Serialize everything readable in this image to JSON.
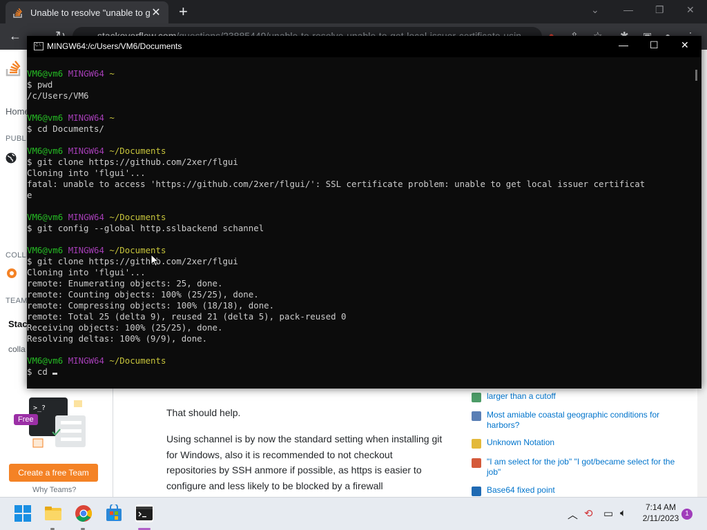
{
  "browser": {
    "tab_title": "Unable to resolve \"unable to get",
    "close_tab": "✕",
    "new_tab": "+",
    "address_host": "stackoverflow.com",
    "address_path": "/questions/23885449/unable-to-resolve-unable-to-get-local-issuer-certificate-usin"
  },
  "page": {
    "left_nav": {
      "home": "Home",
      "public": "PUBLIC",
      "collectives": "COLLE",
      "teams": "TEAMS",
      "stack_teams_title": "Stac Team",
      "teams_desc": "colla shar know",
      "free_badge": "Free",
      "create_team": "Create a free Team",
      "why_teams": "Why Teams?"
    },
    "answer": {
      "p1": "That should help.",
      "p2": "Using schannel is by now the standard setting when installing git for Windows, also it is recommended to not checkout repositories by SSH anmore if possible, as https is easier to configure and less likely to be blocked by a firewall"
    },
    "hot_questions": [
      {
        "text": "larger than a cutoff",
        "icon_color": "#4d9c68"
      },
      {
        "text": "Most amiable coastal geographic conditions for harbors?",
        "icon_color": "#5a7fb5"
      },
      {
        "text": "Unknown Notation",
        "icon_color": "#e3b93b"
      },
      {
        "text": "\"I am select for the job\" \"I got/became select for the job\"",
        "icon_color": "#d45a3a"
      },
      {
        "text": "Base64 fixed point",
        "icon_color": "#1f6ab3"
      }
    ]
  },
  "terminal": {
    "title": "MINGW64:/c/Users/VM6/Documents",
    "lines": [
      {
        "type": "prompt",
        "user": "VM6@vm6",
        "host": "MINGW64",
        "dir": "~"
      },
      {
        "type": "cmd",
        "text": "$ pwd"
      },
      {
        "type": "out",
        "text": "/c/Users/VM6"
      },
      {
        "type": "blank",
        "text": ""
      },
      {
        "type": "prompt",
        "user": "VM6@vm6",
        "host": "MINGW64",
        "dir": "~"
      },
      {
        "type": "cmd",
        "text": "$ cd Documents/"
      },
      {
        "type": "blank",
        "text": ""
      },
      {
        "type": "prompt",
        "user": "VM6@vm6",
        "host": "MINGW64",
        "dir": "~/Documents"
      },
      {
        "type": "cmd",
        "text": "$ git clone https://github.com/2xer/flgui"
      },
      {
        "type": "out",
        "text": "Cloning into 'flgui'..."
      },
      {
        "type": "out",
        "text": "fatal: unable to access 'https://github.com/2xer/flgui/': SSL certificate problem: unable to get local issuer certificat"
      },
      {
        "type": "out",
        "text": "e"
      },
      {
        "type": "blank",
        "text": ""
      },
      {
        "type": "prompt",
        "user": "VM6@vm6",
        "host": "MINGW64",
        "dir": "~/Documents"
      },
      {
        "type": "cmd",
        "text": "$ git config --global http.sslbackend schannel"
      },
      {
        "type": "blank",
        "text": ""
      },
      {
        "type": "prompt",
        "user": "VM6@vm6",
        "host": "MINGW64",
        "dir": "~/Documents"
      },
      {
        "type": "cmd",
        "text": "$ git clone https://github.com/2xer/flgui"
      },
      {
        "type": "out",
        "text": "Cloning into 'flgui'..."
      },
      {
        "type": "out",
        "text": "remote: Enumerating objects: 25, done."
      },
      {
        "type": "out",
        "text": "remote: Counting objects: 100% (25/25), done."
      },
      {
        "type": "out",
        "text": "remote: Compressing objects: 100% (18/18), done."
      },
      {
        "type": "out",
        "text": "remote: Total 25 (delta 9), reused 21 (delta 5), pack-reused 0"
      },
      {
        "type": "out",
        "text": "Receiving objects: 100% (25/25), done."
      },
      {
        "type": "out",
        "text": "Resolving deltas: 100% (9/9), done."
      },
      {
        "type": "blank",
        "text": ""
      },
      {
        "type": "prompt",
        "user": "VM6@vm6",
        "host": "MINGW64",
        "dir": "~/Documents"
      },
      {
        "type": "input",
        "text": "$ cd "
      }
    ]
  },
  "taskbar": {
    "time": "7:14 AM",
    "date": "2/11/2023",
    "notification_count": "1",
    "apps": [
      "windows-start-icon",
      "file-explorer-icon",
      "chrome-icon",
      "microsoft-store-icon",
      "terminal-icon"
    ]
  },
  "colors": {
    "prompt_user": "#25bc24",
    "prompt_host": "#a53eb6",
    "prompt_dir": "#c7c43b",
    "terminal_bg": "#0c0c0c",
    "so_orange": "#f48225"
  }
}
